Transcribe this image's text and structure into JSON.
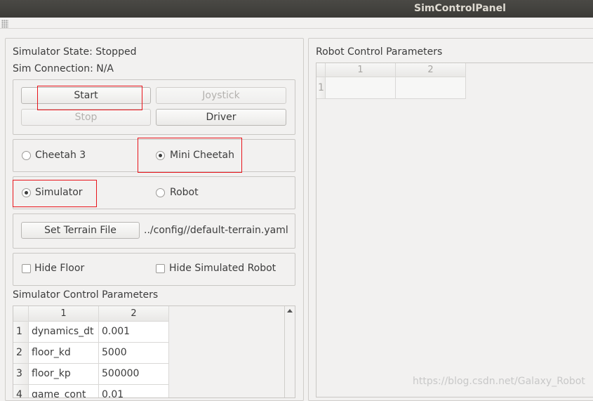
{
  "window": {
    "title": "SimControlPanel"
  },
  "status": {
    "state": "Simulator State: Stopped",
    "connection": "Sim Connection: N/A"
  },
  "buttons": {
    "start": "Start",
    "joystick": "Joystick",
    "stop": "Stop",
    "driver": "Driver",
    "set_terrain": "Set Terrain File"
  },
  "robot_type": {
    "cheetah3": "Cheetah 3",
    "mini_cheetah": "Mini Cheetah",
    "selected": "Mini Cheetah"
  },
  "mode": {
    "simulator": "Simulator",
    "robot": "Robot",
    "selected": "Simulator"
  },
  "terrain_file": "../config//default-terrain.yaml",
  "options": {
    "hide_floor": "Hide Floor",
    "hide_simulated_robot": "Hide Simulated Robot"
  },
  "sim_params": {
    "title": "Simulator Control Parameters",
    "columns": [
      "1",
      "2"
    ],
    "rows": [
      {
        "index": "1",
        "name": "dynamics_dt",
        "value": "0.001"
      },
      {
        "index": "2",
        "name": "floor_kd",
        "value": "5000"
      },
      {
        "index": "3",
        "name": "floor_kp",
        "value": "500000"
      },
      {
        "index": "4",
        "name": "game_cont",
        "value": "0.01"
      }
    ]
  },
  "robot_params": {
    "title": "Robot Control Parameters",
    "columns": [
      "1",
      "2"
    ],
    "row_index": "1"
  },
  "watermark": "https://blog.csdn.net/Galaxy_Robot",
  "highlight_color": "#e8141b"
}
